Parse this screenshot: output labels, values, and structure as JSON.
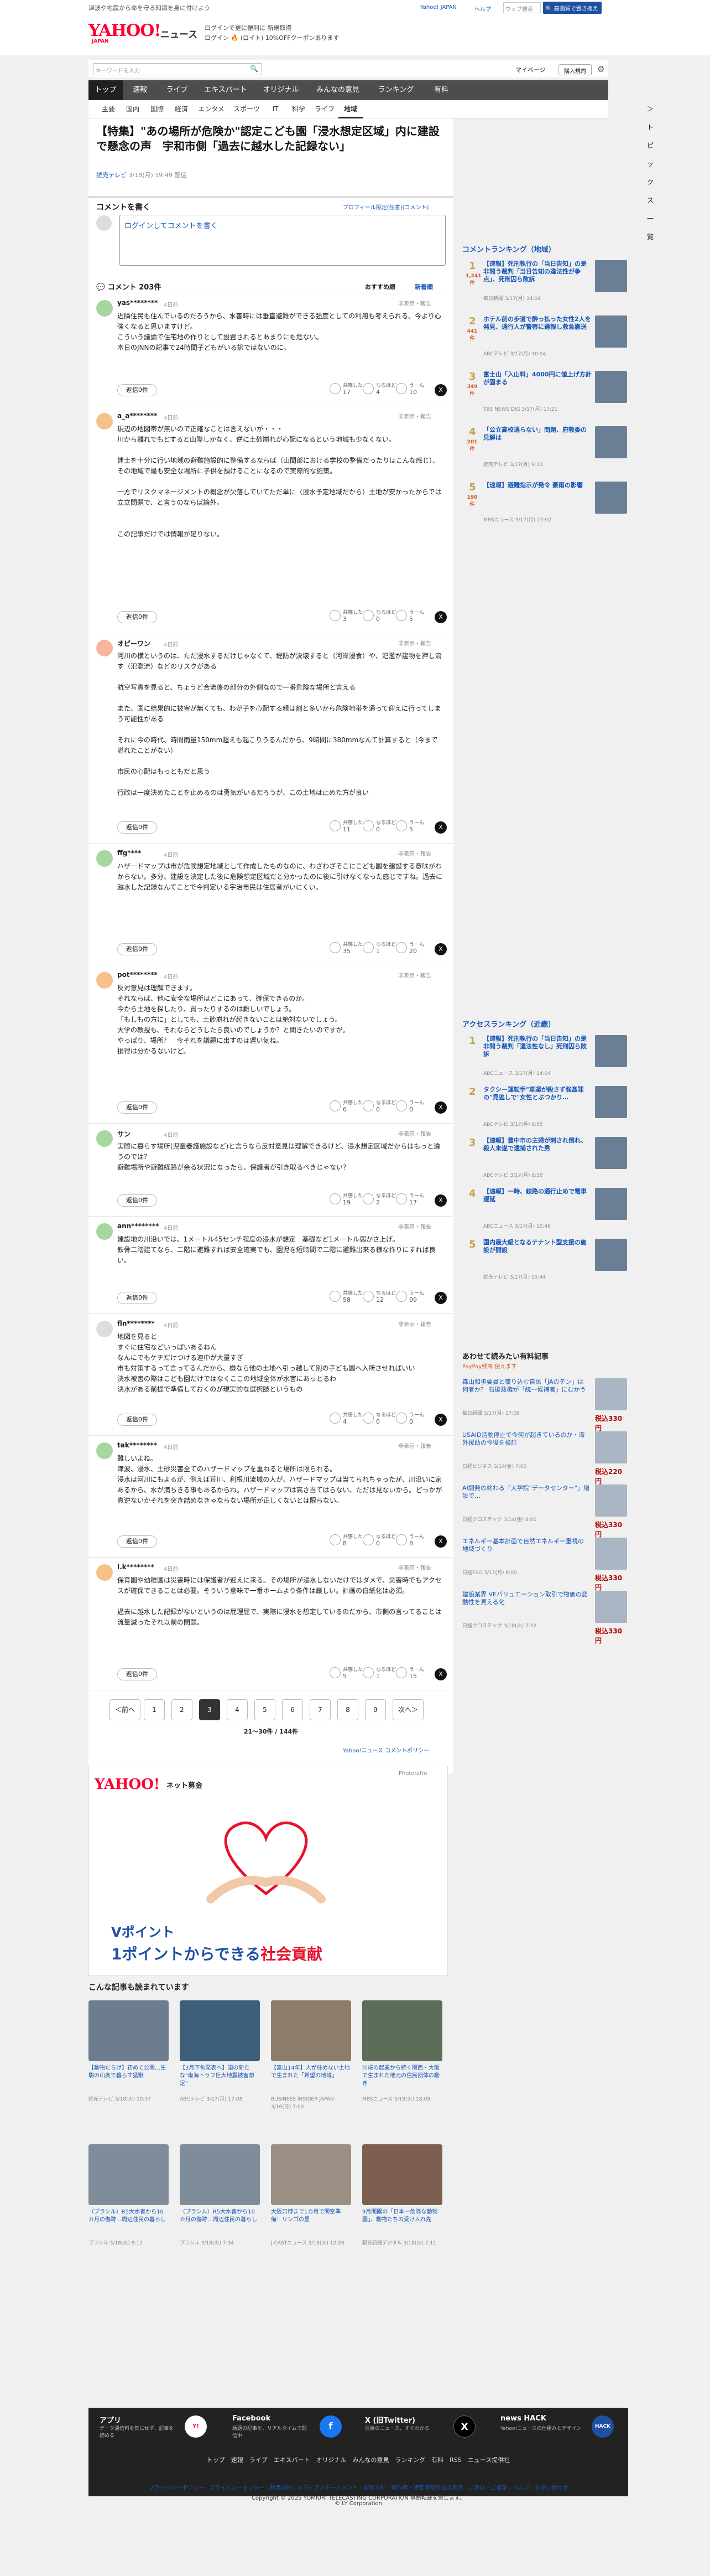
{
  "header": {
    "topnote": "津波や地震から命を守る知識を身に付けよう",
    "logo_main": "YAHOO!",
    "logo_sub": "JAPAN",
    "logo_news": "ニュース",
    "promo_line1": "ログインで更に便利に 新規取得",
    "promo_line2": "ログイン 🔥 (ロイト) 10%OFFクーポンあります",
    "links": [
      "Yahoo! JAPAN",
      "ヘルプ"
    ],
    "search_placeholder": "ウェブ検索",
    "search_button": "🔍 高画質で置き換える",
    "keyword_placeholder": "キーワードを入力",
    "mypage": "マイページ",
    "register": "購入規約"
  },
  "nav": {
    "items": [
      "トップ",
      "速報",
      "ライブ",
      "エキスパート",
      "オリジナル",
      "みんなの意見",
      "ランキング",
      "有料"
    ],
    "active_index": 0,
    "sub": [
      "主要",
      "国内",
      "国際",
      "経済",
      "エンタメ",
      "スポーツ",
      "IT",
      "科学",
      "ライフ",
      "地域"
    ],
    "sub_active_index": 9,
    "topics_link": "＞トピックス一覧"
  },
  "article": {
    "title": "【特集】\"あの場所が危険か\"認定こども園「浸水想定区域」内に建設で懸念の声　宇和市側「過去に越水した記録ない」",
    "source": "読売テレビ",
    "date": "3/18(月) 19:49 配信"
  },
  "comment_form": {
    "label": "コメントを書く",
    "profile_note": "プロフィール設定(任意)(コメント)",
    "placeholder": "ログインしてコメントを書く"
  },
  "comments_bar": {
    "count": "コメント 203件",
    "sort_recommended": "おすすめ順",
    "sort_new": "新着順"
  },
  "reply_label": "返信0件",
  "hide_label": "非表示・報告",
  "reaction_labels": [
    "共感した",
    "なるほど",
    "うーん"
  ],
  "comments": [
    {
      "user": "yas********",
      "time": "4日前",
      "text": "近隣住民も住んでいるのだろうから、水害時には垂直避難ができる強度としての利用も考えられる。今より心強くなると思いますけど。\nこういう議論で住宅地の作りとして設置されるとあまりにも危ない。\n本日のJNNの記事で24時間子どもがいる訳ではないのに。",
      "r": [
        17,
        4,
        10
      ]
    },
    {
      "user": "a_a********",
      "time": "4日前",
      "text": "現辺の地図帯が無いので正確なことは言えないが・・・\n川から離れでもとすると山際しかなく、逆に土砂崩れが心配になるという地域も少なくない。\n\n建土を十分に行い地域の避難施設的に整備するならば（山間部における学校の整備だったりはこんな感じ）、その地域で最も安全な場所に子供を預けることになるので実際的な施策。\n\n一方でリスクマネージメントの概念が欠落していてただ単に（浸水予定地域だから）土地が安かったからでは立立問題で、と言うのならば論外。\n\n\nこの記事だけでは情報が足りない。",
      "r": [
        3,
        0,
        5
      ]
    },
    {
      "user": "オピーワン",
      "time": "4日前",
      "text": "河川の横というのは、ただ浸水するだけじゃなくて、堤防が決壊すると（河岸浸食）や、氾濫が建物を押し流す（氾濫流）などのリスクがある\n\n航空写真を見ると、ちょうど合流後の部分の外側なので一番危険な場所と言える\n\nまた、国に結果的に被害が無くても、わが子を心配する親は割と多いから危険地帯を通って迎えに行ってしまう可能性がある\n\nそれに今の時代、時間雨量150mm超えも起こりうるんだから、9時間に380mmなんて計算すると（今まで溢れたことがない）\n\n市民の心配はもっともだと思う\n\n行政は一度決めたことを止めるのは勇気がいるだろうが、この土地は止めた方が良い",
      "r": [
        11,
        0,
        5
      ]
    },
    {
      "user": "ffg****",
      "time": "4日前",
      "text": "ハザードマップは市が危険想定地域として作成したものなのに、わざわざそこにこども園を建設する意味がわからない。多分、建設を決定した後に危険想定区域だと分かったのに後に引けなくなった感じですね。過去に越水した記録なんてことで今判定いる宇治市民は住居者がいにくい。",
      "r": [
        35,
        1,
        20
      ]
    },
    {
      "user": "pot********",
      "time": "4日前",
      "text": "反対意見は理解できます。\nそれならば、他に安全な場所はどこにあって、確保できるのか。\n今から土地を探したり、買ったりするのは難しいでしょう。\n「もしもの方に」としても、土砂崩れが起きないことは絶対ないでしょう。\n大学の教授も、それならどうしたら良いのでしょうか？と聞きたいのですが。\nやっぱり、場所？　今それを議題に出すのは遅い気ね。\n損得は分かるないけど。",
      "r": [
        6,
        0,
        0
      ]
    },
    {
      "user": "サン",
      "time": "4日前",
      "text": "実際に暮らす場所(児童養護施設など)と言うなら反対意見は理解できるけど、浸水想定区域だからはもっと違うのでは？\n避難場所や避難経路が余る状況になったら、保護者が引き取るべきじゃない？",
      "r": [
        19,
        2,
        17
      ]
    },
    {
      "user": "ann********",
      "time": "4日前",
      "text": "建設地の川沿いでは、1メートル45センチ程度の浸水が想定　基礎など1メートル弱かさ上げ。\n鉄骨二階建てなら、二階に避難すれば安全確実でも、園児を短時間で二階に避難出来る様な作りにすれば良い。",
      "r": [
        58,
        12,
        99
      ]
    },
    {
      "user": "fln********",
      "time": "4日前",
      "text": "地図を見ると\nすぐに住宅などいっぱいあるねん\nなんにでもケチだけつける連中が大量すぎ\n市も対策するって言ってるんだから、嫌なら他の土地へ引っ越して別の子ども園へ入所させればいい\n決水被害の際はこども園だけではなくここの地域全体が水害にあっとるわ\n決水がある前提で準備しておくのが現実的な選択肢というもの",
      "r": [
        4,
        0,
        0
      ]
    },
    {
      "user": "tak********",
      "time": "4日前",
      "text": "難しいよね。\n津波、浸水、土砂災害全てのハザードマップを重ねると場所は限られる。\n浸水は河川にもよるが、例えば荒川、利根川流域の人が、ハザードマップは当てられちゃったが、川沿いに家あるから、水が満ちきる事もあるからね。ハザードマップは高さ当てはらない、ただは見ないから。どっかが真逆ないかそれを突き詰めなきゃならない場所が正しくないとは限らない。",
      "r": [
        8,
        0,
        8
      ]
    },
    {
      "user": "i.k********",
      "time": "4日前",
      "text": "保育園や幼稚園は災害時には保護者が迎えに来る。その場所が浸水しないだけではダメで、災害時でもアクセスが確保できることは必要。そういう意味で一番ホームより条件は厳しい。計画の白紙化は必須。\n\n過去に越水した記録がないというのは屁理屈で、実際に浸水を想定しているのだから、市側の言ってることは流量減ったそれ以前の問題。",
      "r": [
        5,
        1,
        15
      ]
    }
  ],
  "pager": {
    "prev": "＜前へ",
    "pages": [
      "1",
      "2",
      "3",
      "4",
      "5",
      "6",
      "7",
      "8",
      "9"
    ],
    "current": "3",
    "next": "次へ＞",
    "count": "21〜30件 / 144件",
    "more": "Yahoo!ニュース コメントポリシー"
  },
  "ad": {
    "logo": "YAHOO!",
    "logo_sub": "ネット募金",
    "photo": "Photo:afro",
    "line1": "Vポイント",
    "line2_a": "1ポイントからできる",
    "line2_b": "社会貢献"
  },
  "reco": {
    "title": "こんな記事も読まれています",
    "items": [
      {
        "caption": "【動物だらけ】初めて公開…生駒の山奥で暮らす猛獣",
        "pub": "読売テレビ 3/18(火) 10:37"
      },
      {
        "caption": "【3月下旬発表へ】国の新たな\"南海トラフ巨大地震被害想定\"",
        "pub": "ABCテレビ 3/17(月) 17:08"
      },
      {
        "caption": "【富山14年】人が住めない土地で生まれた「希望の地域」",
        "pub": "BUSINESS INSIDER JAPAN 3/16(日) 7:00"
      },
      {
        "caption": "川端の起業から続く関西・大阪で生まれた地元の住民団体の動き",
        "pub": "MBSニュース 3/18(火) 18:09"
      },
      {
        "caption": "（プラシル）R5大水害から10カ月の傷跡…周辺住民の暮らし",
        "pub": "プラシル 3/18(火) 9:17"
      },
      {
        "caption": "（プラシル）R5大水害から10カ月の傷跡…周辺住民の暮らし",
        "pub": "プラシル 3/18(火) 7:34"
      },
      {
        "caption": "大阪万博まで1カ月で関空準備！リンゴの里",
        "pub": "J-CASTニュース 3/18(火) 12:26"
      },
      {
        "caption": "9月開園の「日本一危険な動物園」、動物たちの受け入れ先",
        "pub": "朝日新聞デジタル 3/18(火) 7:11"
      }
    ]
  },
  "side": {
    "ranking_title": "コメントランキング（地域）",
    "ranking": [
      {
        "n": "1",
        "c": "1,241件",
        "t": "【速報】死刑執行の「当日告知」の是非問う裁判「当日告知の違法性が争点」、死刑囚ら敗訴",
        "p": "毎日新聞 3/17(月) 14:04"
      },
      {
        "n": "2",
        "c": "441件",
        "t": "ホテル前の歩道で酔っ払った女性2人を発見、通行人が警察に通報し救急搬送",
        "p": "ABCテレビ 3/17(月) 10:04"
      },
      {
        "n": "3",
        "c": "349件",
        "t": "富士山「入山料」4000円に値上げ方針が固まる",
        "p": "TBS NEWS DIG 3/17(月) 17:21"
      },
      {
        "n": "4",
        "c": "201件",
        "t": "「公立高校通らない」問題、府教委の見解は",
        "p": "読売テレビ 3/17(月) 9:33"
      },
      {
        "n": "5",
        "c": "190件",
        "t": "【速報】避難指示が発令 豪雨の影響",
        "p": "MBSニュース 3/17(月) 15:02"
      }
    ],
    "access_title": "アクセスランキング（近畿）",
    "access": [
      {
        "n": "1",
        "t": "【速報】死刑執行の「当日告知」の是非問う裁判「違法性なし」死刑囚ら敗訴",
        "p": "ABCニュース 3/17(月) 14:04"
      },
      {
        "n": "2",
        "t": "タクシー運転手\"車運が殺さず強姦罪の\"見逃しで\"女性とぶつかり…",
        "p": "ABCテレビ 3/17(月) 8:55"
      },
      {
        "n": "3",
        "t": "【速報】豊中市の主婦が刺され倒れ、殺人未遂で逮捕された男",
        "p": "ABCテレビ 3/17(月) 8:58"
      },
      {
        "n": "4",
        "t": "【速報】一時、線路の通行止めで電車遅延",
        "p": "ABCニュース 3/17(月) 10:46"
      },
      {
        "n": "5",
        "t": "国内最大級となるテナント型支援の施設が開設",
        "p": "読売テレビ 3/17(月) 15:44"
      }
    ],
    "ads_title": "あわせて読みたい有料記事",
    "ads_sub": "PayPay残高 使えます",
    "ads": [
      {
        "t": "森山和歩要員と盛り込む自民「JAのテン」は何者か？ 石破政権が「統一候補者」にむかう",
        "p": "毎日新聞 3/17(月) 17:08",
        "pr": "税込330円"
      },
      {
        "t": "USAID活動停止で今何が起きているのか・海外援助の今後を検証",
        "p": "日経ビジネス 3/14(金) 7:00",
        "pr": "税込220円"
      },
      {
        "t": "AI開発の終わる「大学院\"データセンター\"」増設で…",
        "p": "日経クロステック 3/14(金) 8:00",
        "pr": "税込330円"
      },
      {
        "t": "エネルギー基本計画で自然エネルギー重視の地域づくり",
        "p": "日経ESG 3/17(月) 8:00",
        "pr": "税込330円"
      },
      {
        "t": "建設業界 VEバリュエーション取引で物価の変動性を見える化",
        "p": "日経クロステック 3/18(火) 7:32",
        "pr": "税込330円"
      }
    ]
  },
  "footer": {
    "cols": [
      {
        "title": "アプリ",
        "desc": "データ通信料を気にせず、記事を読める"
      },
      {
        "title": "Facebook",
        "desc": "話題の記事を、リアルタイムで配信中"
      },
      {
        "title": "X (旧Twitter)",
        "desc": "注目のニュース、すぐわかる"
      },
      {
        "title": "news HACK",
        "desc": "Yahoo!ニュースの仕組みとデザイン"
      }
    ],
    "nav": "トップ　速報　ライブ　エキスパート　オリジナル　みんなの意見　ランキング　有料　RSS　ニュース提供社",
    "links": "プライバシーポリシー - プライバシーセンター - 利用規約 - メディアステートメント - 運営方針 - 著作権・特定商取引法の表示 - ご意見・ご要望 - ヘルプ - お問い合わせ",
    "copyright": "Copyright © 2025 YOMIURI TELECASTING CORPORATION 無断転載を禁じます。",
    "copyright2": "© LY Corporation"
  }
}
